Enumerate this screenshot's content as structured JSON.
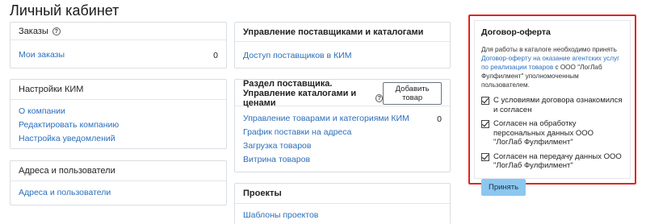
{
  "page": {
    "title": "Личный кабинет"
  },
  "orders": {
    "title": "Заказы",
    "items": [
      {
        "label": "Мои заказы",
        "count": "0"
      }
    ]
  },
  "kim_settings": {
    "title": "Настройки КИМ",
    "items": [
      {
        "label": "О компании"
      },
      {
        "label": "Редактировать компанию"
      },
      {
        "label": "Настройка уведомлений"
      }
    ]
  },
  "addresses": {
    "title": "Адреса и пользователи",
    "items": [
      {
        "label": "Адреса и пользователи"
      }
    ]
  },
  "suppliers": {
    "title": "Управление поставщиками и каталогами",
    "items": [
      {
        "label": "Доступ поставщиков в КИМ"
      }
    ]
  },
  "supplier_section": {
    "title_line1": "Раздел поставщика.",
    "title_line2": "Управление каталогами и ценами",
    "add_button": "Добавить товар",
    "items": [
      {
        "label": "Управление товарами и категориями КИМ",
        "count": "0"
      },
      {
        "label": "График поставки на адреса"
      },
      {
        "label": "Загрузка товаров"
      },
      {
        "label": "Витрина товаров"
      }
    ]
  },
  "projects": {
    "title": "Проекты",
    "items": [
      {
        "label": "Шаблоны проектов"
      }
    ]
  },
  "offer": {
    "title": "Договор-оферта",
    "desc_prefix": "Для работы в каталоге необходимо принять ",
    "desc_link": "Договор-оферту на оказание агентских услуг по реализации товаров",
    "desc_suffix": " с ООО \"ЛогЛаб Фулфилмент\" уполномоченным пользователем.",
    "checks": [
      {
        "label": "С условиями договора ознакомился и согласен",
        "checked": true
      },
      {
        "label": "Согласен на обработку персональных данных ООО \"ЛогЛаб Фулфилмент\"",
        "checked": true
      },
      {
        "label": "Согласен на передачу данных ООО \"ЛогЛаб Фулфилмент\"",
        "checked": true
      }
    ],
    "accept_button": "Принять",
    "highlight_color": "#e02424",
    "button_color": "#8cc7f0"
  },
  "icons": {
    "help": "help-circle-icon",
    "check": "checkmark-icon"
  }
}
